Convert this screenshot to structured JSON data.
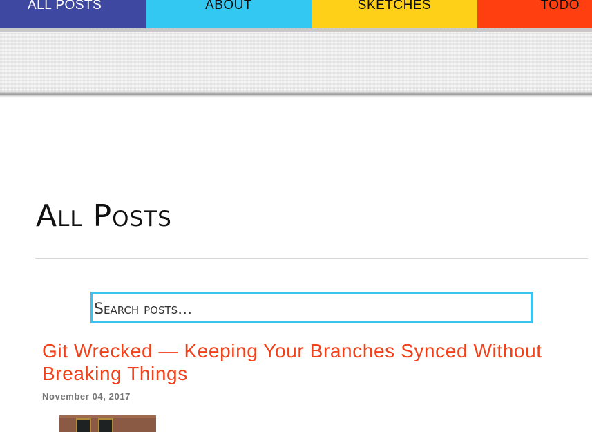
{
  "nav": {
    "items": [
      {
        "label": "All Posts",
        "color": "#3f48a0"
      },
      {
        "label": "About",
        "color": "#33c8f2"
      },
      {
        "label": "Sketches",
        "color": "#ffd018"
      },
      {
        "label": "Todo",
        "color": "#ff3f0f"
      }
    ]
  },
  "page": {
    "title": "All Posts"
  },
  "search": {
    "placeholder": "Search posts...",
    "border_color": "#3bc3ef"
  },
  "posts": [
    {
      "title": "Git Wrecked — Keeping Your Branches Synced Without Breaking Things",
      "date": "November 04, 2017",
      "title_color": "#f2401a"
    }
  ]
}
